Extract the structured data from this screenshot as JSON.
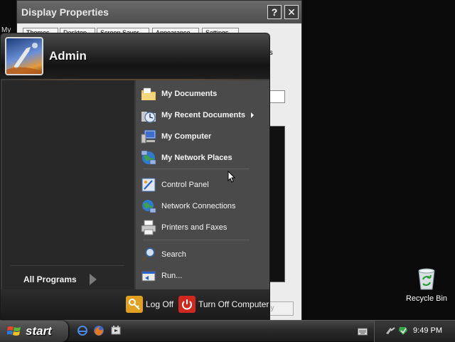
{
  "dialog": {
    "title": "Display Properties",
    "help_label": "?",
    "close_label": "✕",
    "tabs": [
      "Themes",
      "Desktop",
      "Screen Saver",
      "Appearance",
      "Settings"
    ],
    "fragment_right": "ts",
    "apply_fragment": "ply"
  },
  "desktop_fragment": "My",
  "start_menu": {
    "user_name": "Admin",
    "all_programs": "All Programs",
    "right_items": [
      {
        "label": "My Documents",
        "icon": "documents-folder-icon"
      },
      {
        "label": "My Recent Documents",
        "icon": "recent-documents-icon"
      },
      {
        "label": "My Computer",
        "icon": "computer-icon"
      },
      {
        "label": "My Network Places",
        "icon": "network-places-icon"
      },
      {
        "label": "Control Panel",
        "icon": "control-panel-icon"
      },
      {
        "label": "Network Connections",
        "icon": "network-connections-icon"
      },
      {
        "label": "Printers and Faxes",
        "icon": "printer-icon"
      },
      {
        "label": "Search",
        "icon": "search-icon"
      },
      {
        "label": "Run...",
        "icon": "run-icon"
      }
    ],
    "log_off": "Log Off",
    "turn_off": "Turn Off Computer"
  },
  "desktop": {
    "recycle_bin": "Recycle Bin"
  },
  "taskbar": {
    "start": "start",
    "clock": "9:49 PM"
  },
  "colors": {
    "log_off": "#e0a020",
    "turn_off": "#d0281c",
    "accent": "#b56b2a"
  }
}
